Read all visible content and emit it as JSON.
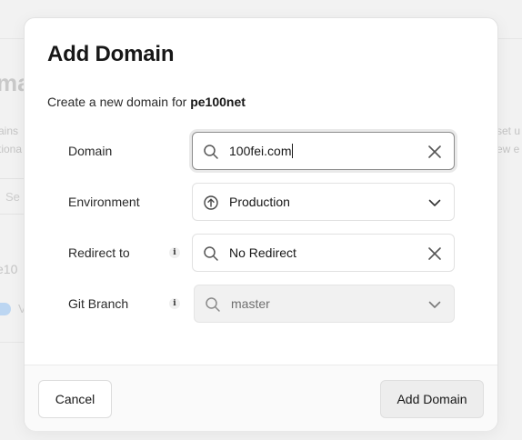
{
  "background": {
    "heading": "ma",
    "left_text": [
      "ains",
      "tiona"
    ],
    "right_text": [
      "set u",
      "ew e"
    ],
    "search_partial": "Se",
    "project_partial": "e10",
    "verified_partial": "V"
  },
  "modal": {
    "title": "Add Domain",
    "description_prefix": "Create a new domain for ",
    "project_name": "pe100net",
    "fields": {
      "domain": {
        "label": "Domain",
        "value": "100fei.com",
        "icon": "search-icon",
        "trail_icon": "clear-icon"
      },
      "environment": {
        "label": "Environment",
        "value": "Production",
        "icon": "arrow-up-circle-icon",
        "trail_icon": "chevron-down-icon"
      },
      "redirect": {
        "label": "Redirect to",
        "value": "No Redirect",
        "icon": "search-icon",
        "trail_icon": "clear-icon",
        "info_icon": "info-icon"
      },
      "git_branch": {
        "label": "Git Branch",
        "value": "master",
        "icon": "search-icon",
        "trail_icon": "chevron-down-icon",
        "info_icon": "info-icon",
        "disabled": true
      }
    },
    "footer": {
      "cancel_label": "Cancel",
      "submit_label": "Add Domain"
    }
  },
  "colors": {
    "modal_bg": "#ffffff",
    "footer_bg": "#fafafa",
    "submit_bg": "#ededed",
    "disabled_field_bg": "#f1f1f1",
    "focus_border": "#8c8c8c"
  }
}
